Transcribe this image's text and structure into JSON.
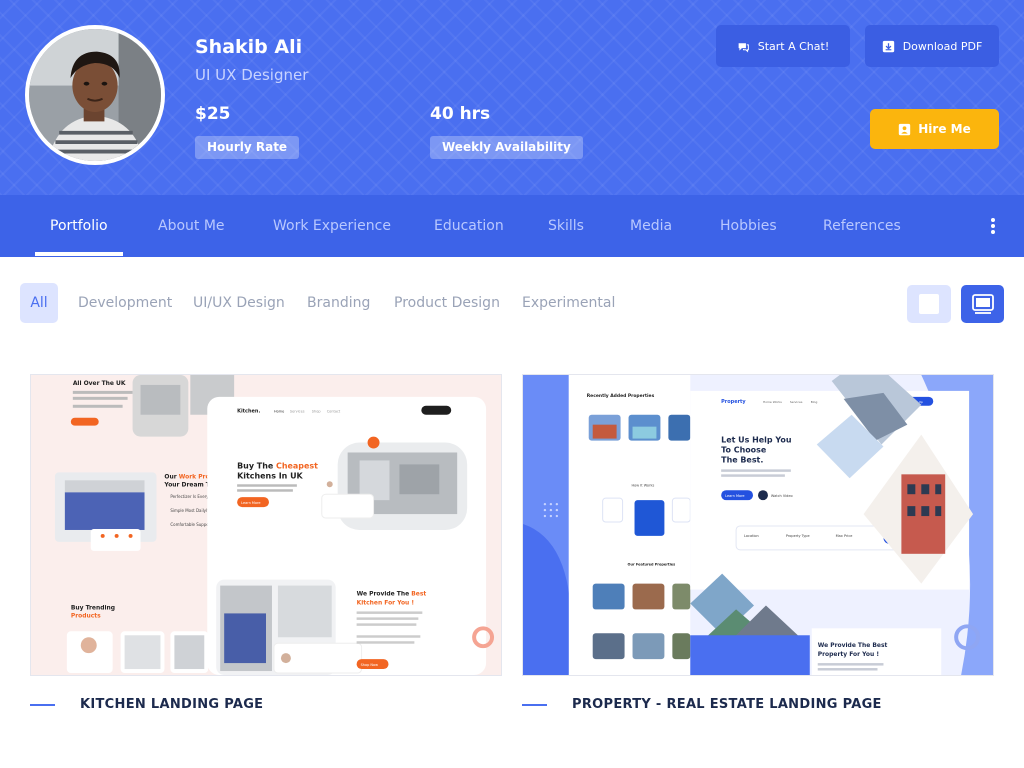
{
  "profile": {
    "name": "Shakib Ali",
    "title": "UI UX Designer",
    "rate_value": "$25",
    "rate_label": "Hourly Rate",
    "availability_value": "40 hrs",
    "availability_label": "Weekly Availability"
  },
  "actions": {
    "chat_label": "Start A Chat!",
    "download_label": "Download PDF",
    "hire_label": "Hire Me"
  },
  "nav": {
    "items": [
      "Portfolio",
      "About Me",
      "Work Experience",
      "Education",
      "Skills",
      "Media",
      "Hobbies",
      "References"
    ],
    "active": "Portfolio"
  },
  "filters": {
    "items": [
      "All",
      "Development",
      "UI/UX Design",
      "Branding",
      "Product Design",
      "Experimental"
    ],
    "active": "All"
  },
  "projects": [
    {
      "caption": "KITCHEN LANDING PAGE",
      "preview": {
        "nav_logo": "Kitchen.",
        "nav_links": [
          "Home",
          "Services",
          "Shop",
          "Contact"
        ],
        "hero_prefix": "Buy The ",
        "hero_highlight": "Cheapest",
        "hero_line2": "Kitchens In UK",
        "left_heading": "All Over The UK",
        "work_prefix": "Our ",
        "work_highlight": "Work Process",
        "work_line2": "Your Dream True",
        "trend_line1": "Buy Trending",
        "trend_line2": "Products",
        "best_prefix": "We Provide The ",
        "best_highlight": "Best",
        "best_line2": "Kitchen For You !",
        "process_items": [
          "Perfectizer Is Every In",
          "Simple Most Dailyly",
          "Comfortable Support"
        ],
        "cta": "Learn More",
        "cta2": "Shop Now"
      }
    },
    {
      "caption": "PROPERTY - REAL ESTATE LANDING PAGE",
      "preview": {
        "nav_logo": "Property",
        "nav_links": [
          "Home Works",
          "Services",
          "Blog"
        ],
        "nav_button": "Sign Up",
        "side_heading": "Recently Added Properties",
        "hero_line1": "Let Us Help You",
        "hero_line2": "To Choose",
        "hero_line3": "The Best.",
        "cta": "Learn More",
        "video": "Watch Video",
        "search_fields": [
          "Location",
          "Property Type",
          "Max Price"
        ],
        "search_button": "Search",
        "how_heading": "How It Works",
        "featured_heading": "Our Featured Properties",
        "best_line1": "We Provide The Best",
        "best_line2": "Property For You !"
      }
    }
  ],
  "colors": {
    "brand": "#4a6ff0",
    "nav_bg": "#3d63e8",
    "hire": "#fbb50d",
    "accent_orange": "#f26522"
  }
}
